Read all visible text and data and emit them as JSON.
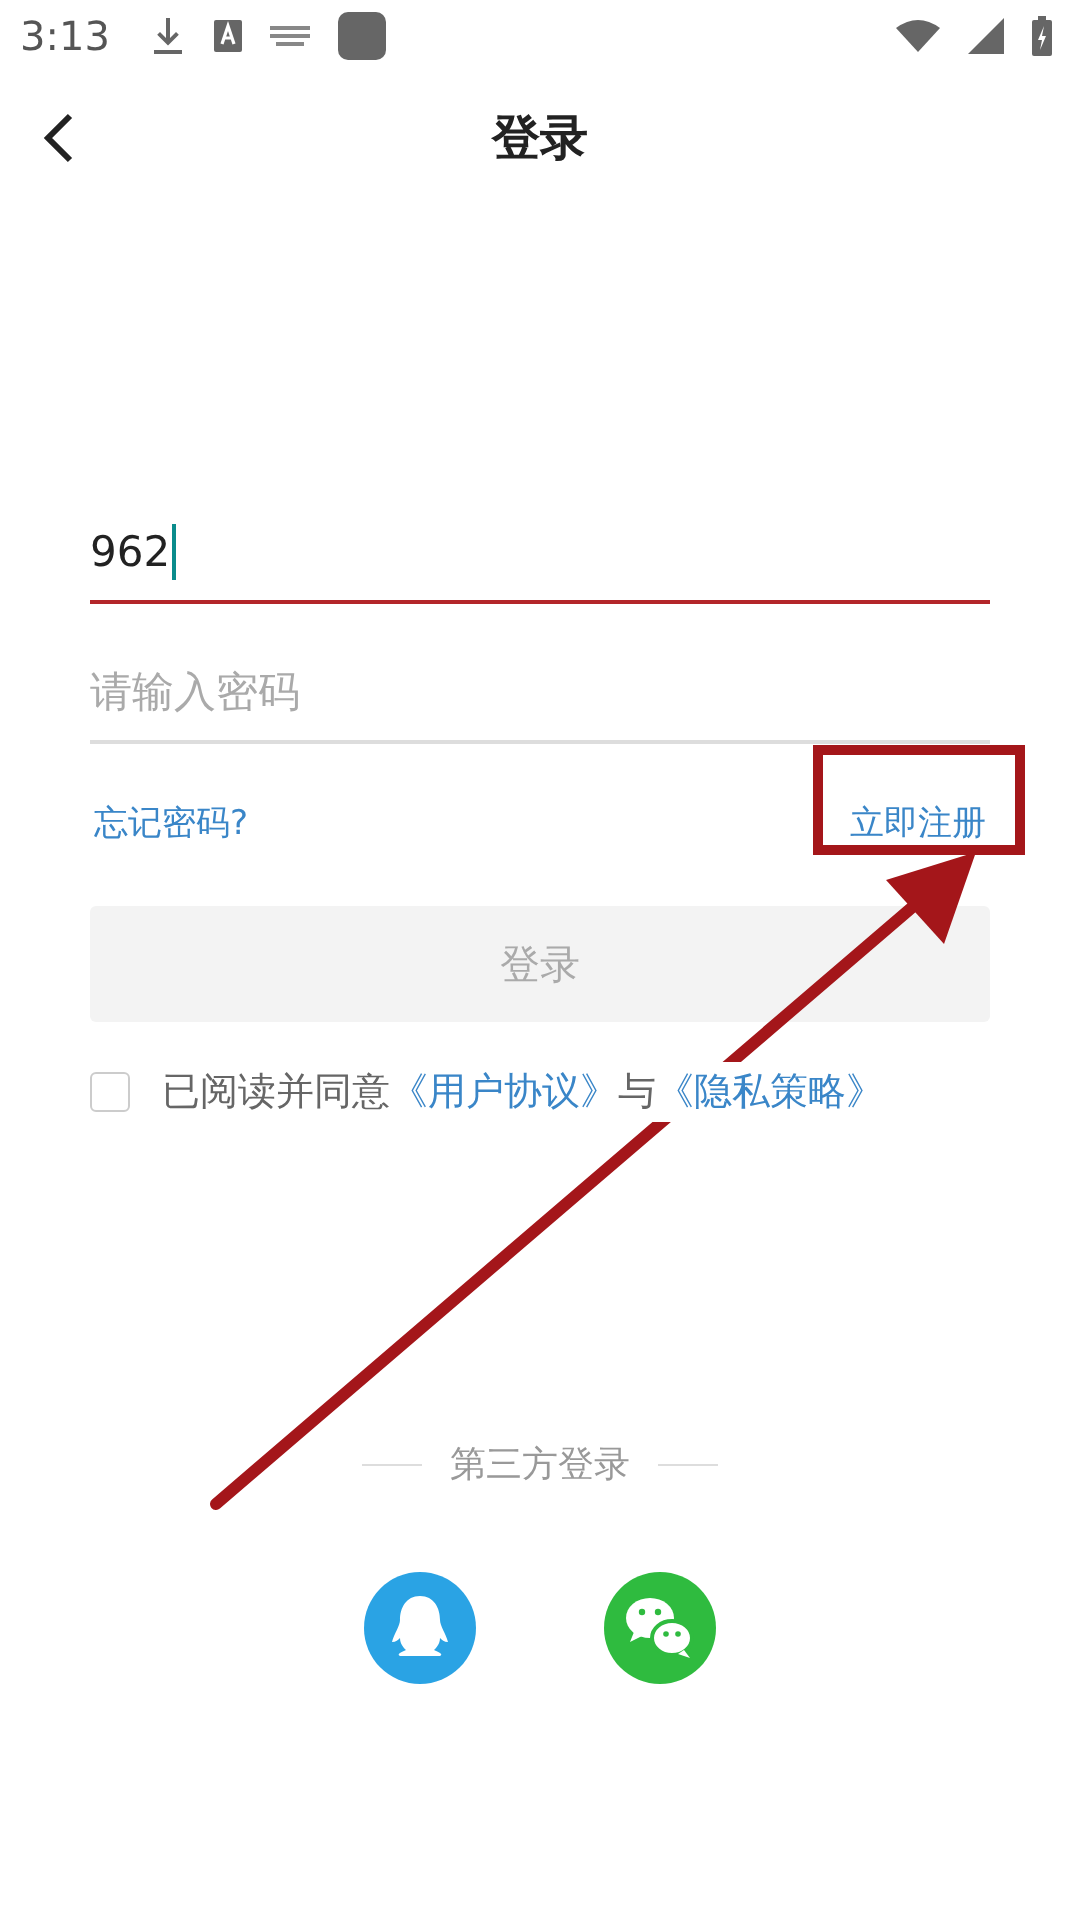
{
  "status_bar": {
    "time": "3:13"
  },
  "header": {
    "title": "登录"
  },
  "phone_field": {
    "value": "962",
    "focused": true
  },
  "password_field": {
    "placeholder": "请输入密码",
    "focused": false
  },
  "links": {
    "forgot": "忘记密码?",
    "register": "立即注册"
  },
  "login_button": {
    "label": "登录",
    "disabled": true
  },
  "agreement": {
    "checked": false,
    "prefix": "已阅读并同意",
    "user_agreement": "《用户协议》",
    "joiner": "与",
    "privacy_policy": "《隐私策略》"
  },
  "third_party": {
    "label": "第三方登录",
    "providers": [
      {
        "kind": "qq"
      },
      {
        "kind": "wechat"
      }
    ]
  }
}
